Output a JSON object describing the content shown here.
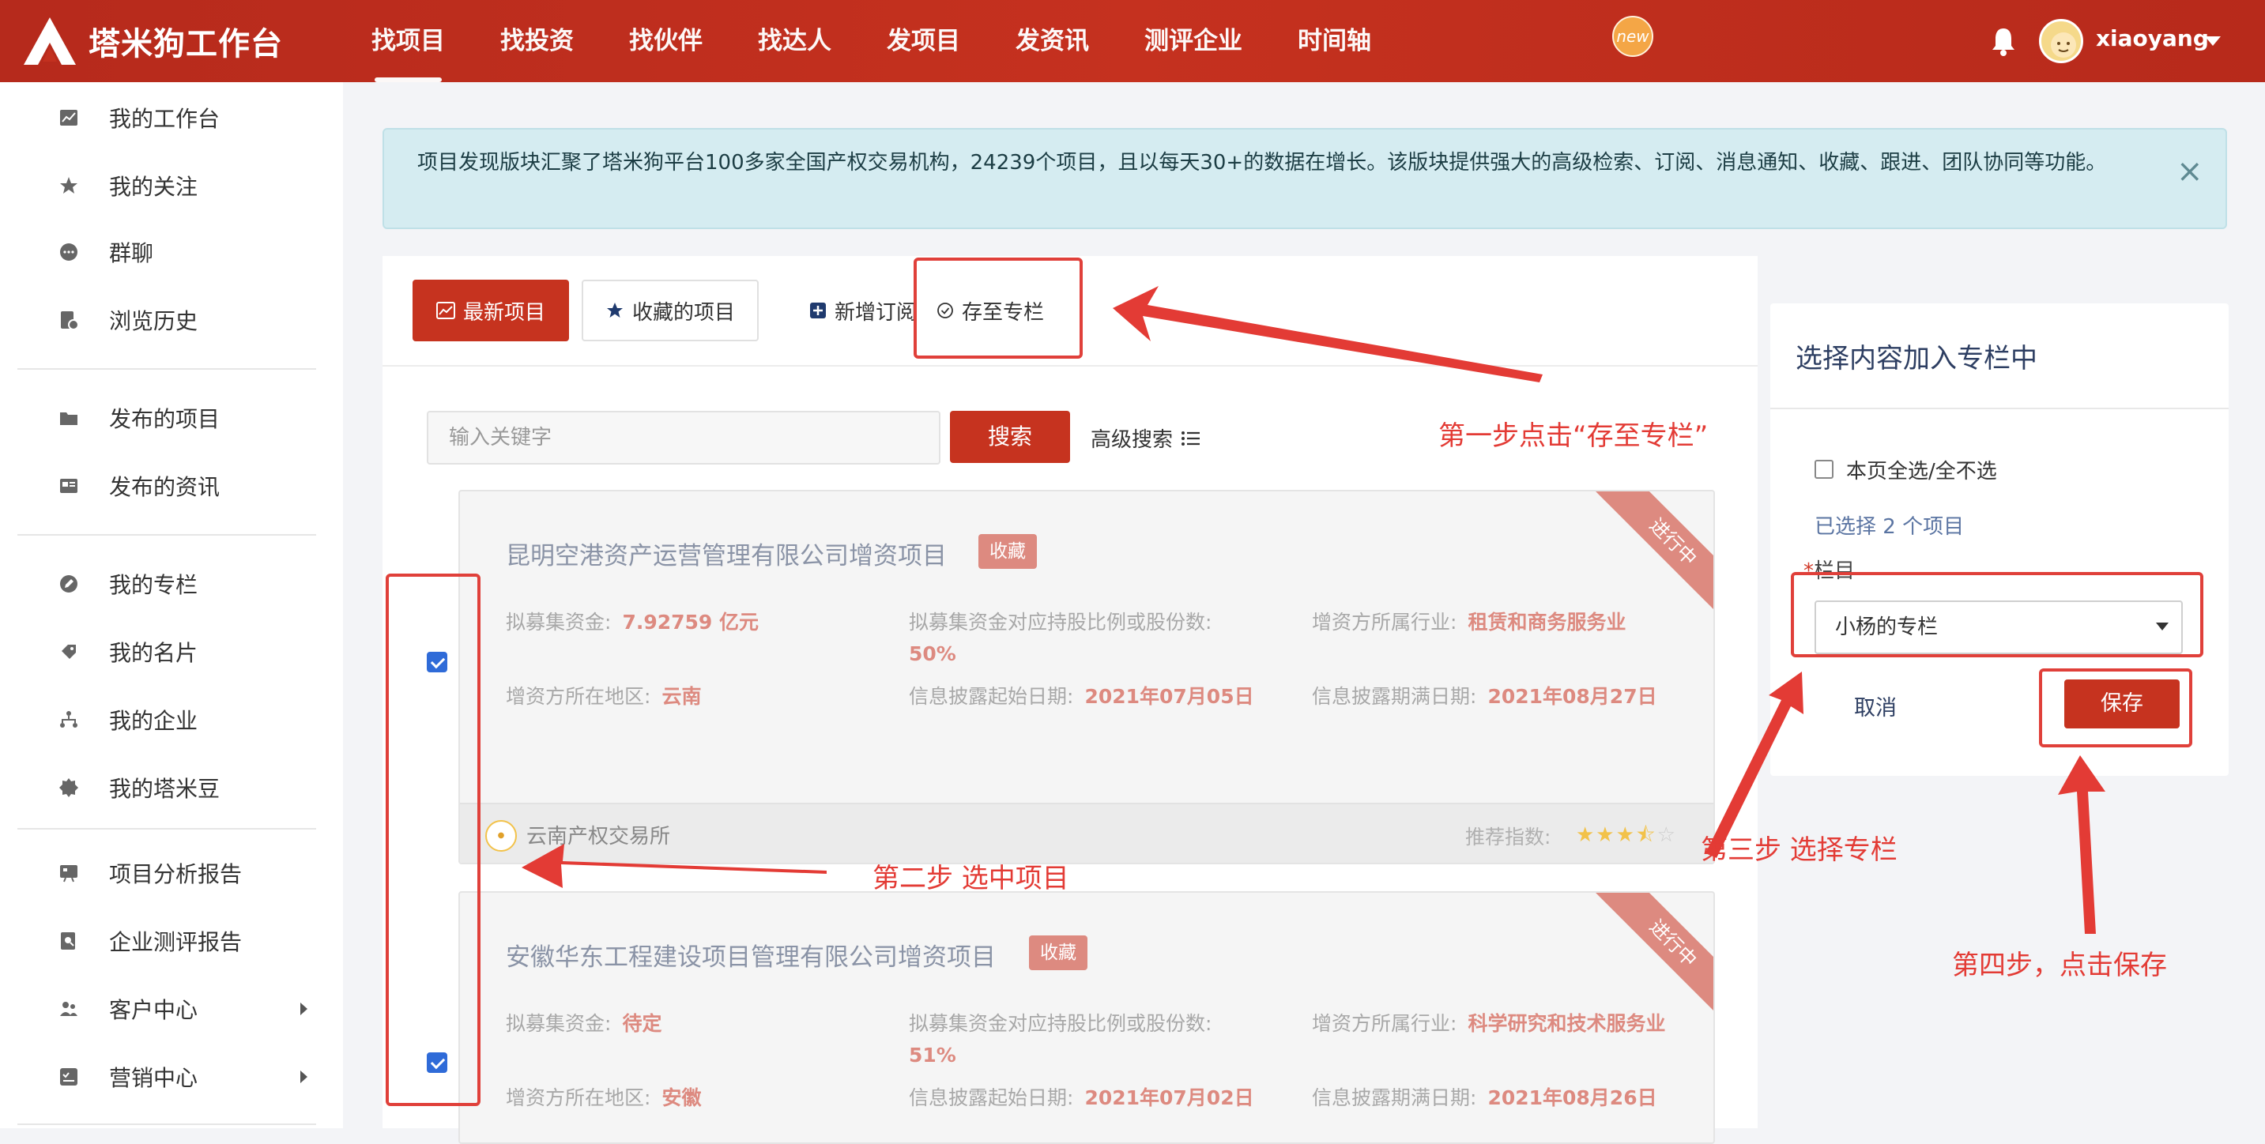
{
  "brand": {
    "name": "塔米狗工作台"
  },
  "nav": {
    "items": [
      "找项目",
      "找投资",
      "找伙伴",
      "找达人",
      "发项目",
      "发资讯",
      "测评企业",
      "时间轴"
    ],
    "new_badge": "new"
  },
  "user": {
    "name": "xiaoyang"
  },
  "sidebar": {
    "items": [
      {
        "label": "我的工作台",
        "icon": "chart-icon"
      },
      {
        "label": "我的关注",
        "icon": "star-icon"
      },
      {
        "label": "群聊",
        "icon": "chat-icon"
      },
      {
        "label": "浏览历史",
        "icon": "history-icon"
      },
      {
        "label": "发布的项目",
        "icon": "folder-icon"
      },
      {
        "label": "发布的资讯",
        "icon": "news-icon"
      },
      {
        "label": "我的专栏",
        "icon": "edit-icon"
      },
      {
        "label": "我的名片",
        "icon": "card-icon"
      },
      {
        "label": "我的企业",
        "icon": "org-icon"
      },
      {
        "label": "我的塔米豆",
        "icon": "coin-icon"
      },
      {
        "label": "项目分析报告",
        "icon": "report-icon"
      },
      {
        "label": "企业测评报告",
        "icon": "search-report-icon"
      },
      {
        "label": "客户中心",
        "icon": "users-icon"
      },
      {
        "label": "营销中心",
        "icon": "marketing-icon"
      }
    ]
  },
  "notice": {
    "text": "项目发现版块汇聚了塔米狗平台100多家全国产权交易机构，24239个项目，且以每天30+的数据在增长。该版块提供强大的高级检索、订阅、消息通知、收藏、跟进、团队协同等功能。"
  },
  "tabs": {
    "latest": "最新项目",
    "favorites": "收藏的项目",
    "subscribe": "新增订阅",
    "save_column": "存至专栏"
  },
  "search": {
    "placeholder": "输入关键字",
    "button": "搜索",
    "advanced": "高级搜索"
  },
  "projects": [
    {
      "title": "昆明空港资产运营管理有限公司增资项目",
      "tag": "收藏",
      "status": "进行中",
      "f1_label": "拟募集资金:",
      "f1_value": "7.92759 亿元",
      "f2_label": "拟募集资金对应持股比例或股份数:",
      "f2_value": "50%",
      "f3_label": "增资方所属行业:",
      "f3_value": "租赁和商务服务业",
      "f4_label": "增资方所在地区:",
      "f4_value": "云南",
      "f5_label": "信息披露起始日期:",
      "f5_value": "2021年07月05日",
      "f6_label": "信息披露期满日期:",
      "f6_value": "2021年08月27日",
      "exchange": "云南产权交易所",
      "recommend_label": "推荐指数:",
      "stars": 3.5
    },
    {
      "title": "安徽华东工程建设项目管理有限公司增资项目",
      "tag": "收藏",
      "status": "进行中",
      "f1_label": "拟募集资金:",
      "f1_value": "待定",
      "f2_label": "拟募集资金对应持股比例或股份数:",
      "f2_value": "51%",
      "f3_label": "增资方所属行业:",
      "f3_value": "科学研究和技术服务业",
      "f4_label": "增资方所在地区:",
      "f4_value": "安徽",
      "f5_label": "信息披露起始日期:",
      "f5_value": "2021年07月02日",
      "f6_label": "信息披露期满日期:",
      "f6_value": "2021年08月26日"
    }
  ],
  "column_panel": {
    "title": "选择内容加入专栏中",
    "select_all": "本页全选/全不选",
    "selected_prefix": "已选择",
    "selected_count": "2",
    "selected_suffix": "个项目",
    "column_label": "栏目",
    "column_required": "*",
    "column_value": "小杨的专栏",
    "cancel": "取消",
    "save": "保存"
  },
  "annotations": {
    "step1": "第一步点击“存至专栏”",
    "step2": "第二步 选中项目",
    "step3": "第三步 选择专栏",
    "step4": "第四步，点击保存"
  },
  "colors": {
    "brand_red": "#c6331f",
    "annotation_red": "#e33b35",
    "notice_bg": "#d5ecf1"
  }
}
